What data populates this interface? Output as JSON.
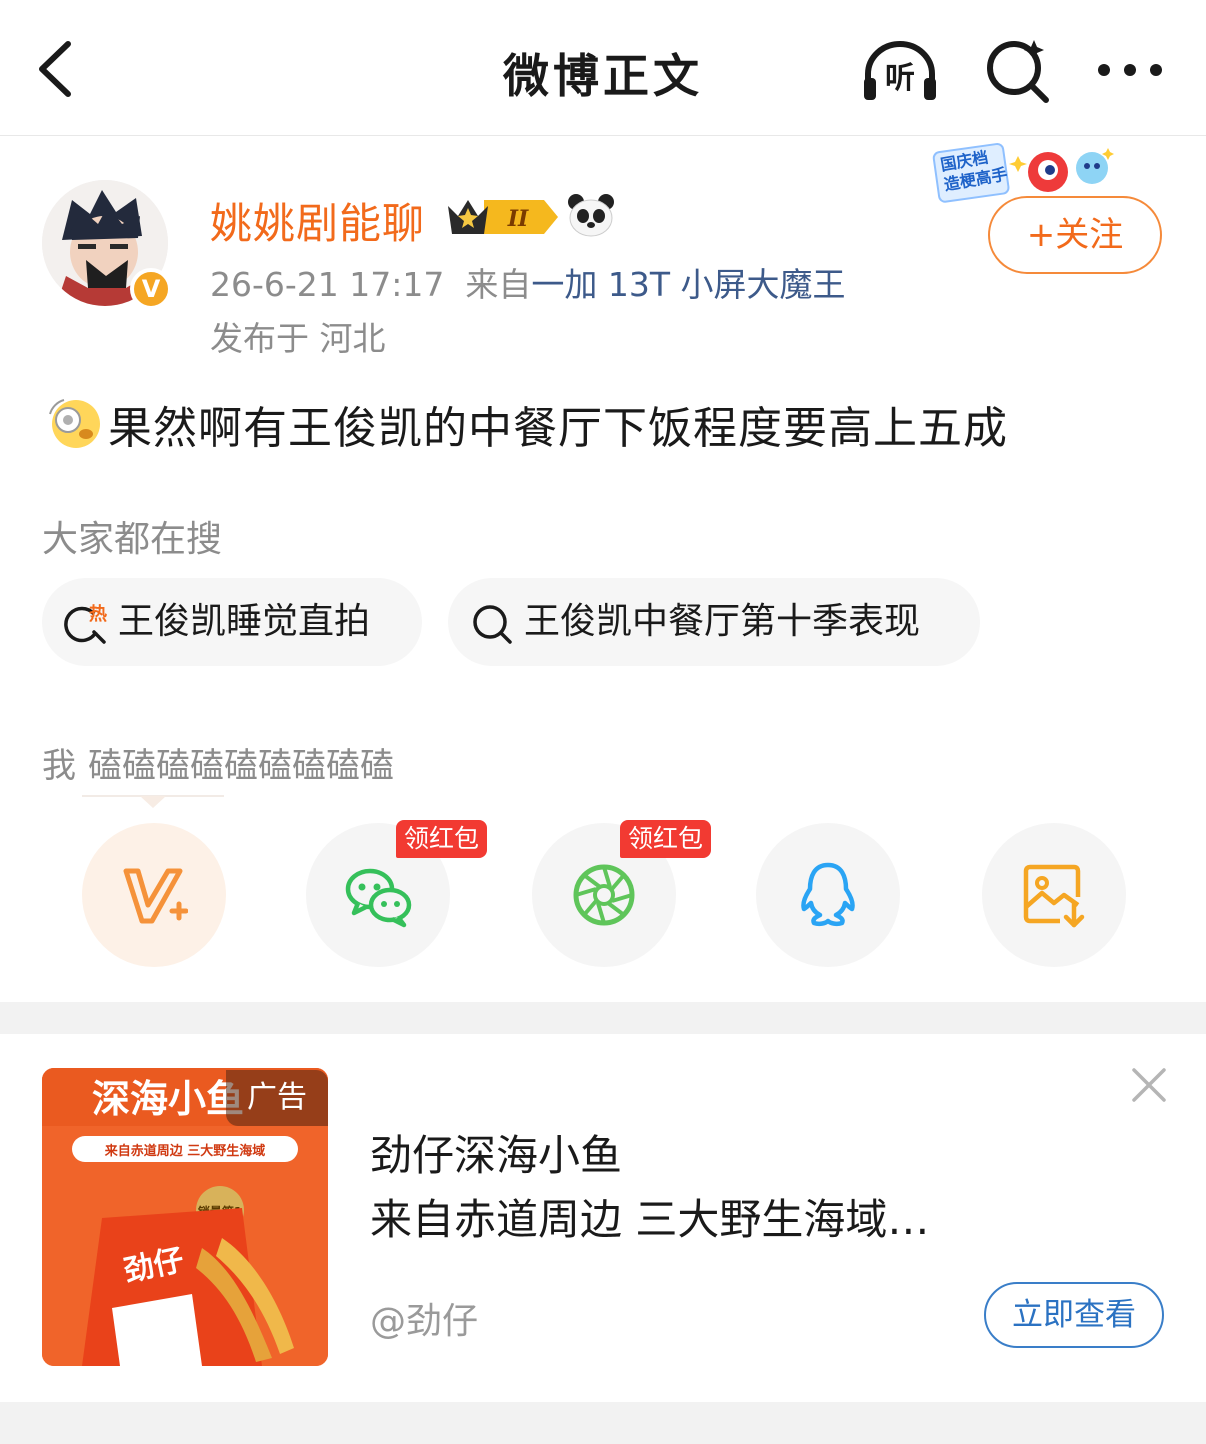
{
  "header": {
    "title": "微博正文",
    "listen_label": "听"
  },
  "author": {
    "name": "姚姚剧能聊",
    "level_badge": "II",
    "verified_mark": "V",
    "timestamp": "26-6-21 17:17",
    "from_prefix": "来自",
    "source": "一加 13T 小屏大魔王",
    "location": "发布于 河北",
    "follow_label": "+关注",
    "festival_badge_line1": "国庆档",
    "festival_badge_line2": "造梗高手"
  },
  "post": {
    "text": "果然啊有王俊凯的中餐厅下饭程度要高上五成"
  },
  "search": {
    "title": "大家都在搜",
    "hot_label": "热",
    "chips": [
      {
        "label": "王俊凯睡觉直拍"
      },
      {
        "label": "王俊凯中餐厅第十季表现"
      }
    ]
  },
  "me_line": {
    "me": "我",
    "text": "磕磕磕磕磕磕磕磕磕"
  },
  "share": {
    "redpacket_label_1": "领红包",
    "redpacket_label_2": "领红包"
  },
  "ad": {
    "tag": "广告",
    "image_title": "深海小鱼",
    "image_sub": "来自赤道周边 三大野生海域",
    "image_brand": "劲仔",
    "image_rank": "销量第1",
    "title_line1": "劲仔深海小鱼",
    "title_line2": "来自赤道周边 三大野生海域…",
    "account": "@劲仔",
    "cta": "立即查看"
  },
  "colors": {
    "accent_orange": "#f26a1b",
    "link_blue": "#3d5a8a",
    "cta_blue": "#2b72c2",
    "red_tag": "#f23a32",
    "wechat_green": "#35c05a",
    "qq_blue": "#2aa4f4",
    "save_orange": "#f5a623"
  }
}
